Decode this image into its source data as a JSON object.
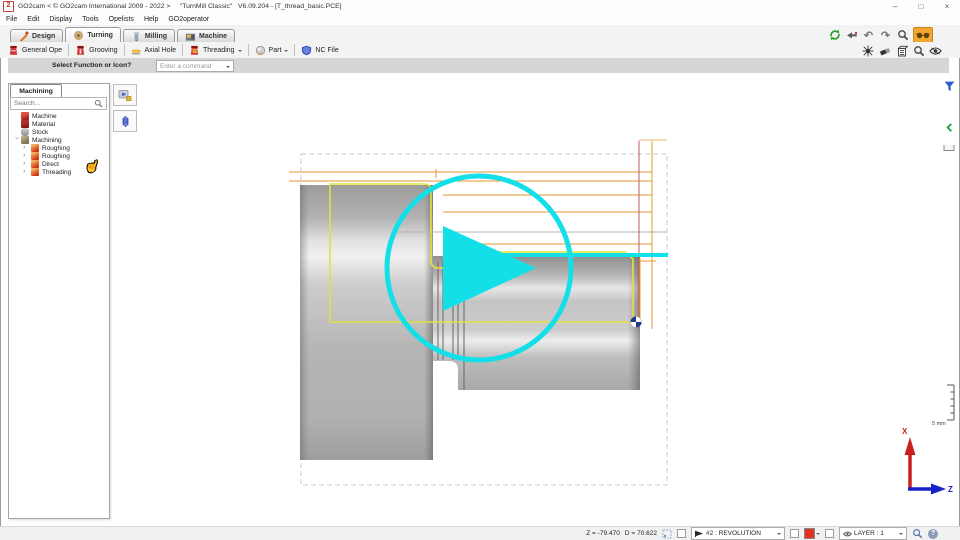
{
  "window": {
    "title": "GO2cam < © GO2cam International 2009 - 2022 >     \"TurnMill Classic\"   V6.09.204 - [T_thread_basic.PCE]",
    "logo": "2",
    "minimize": "–",
    "maximize": "□",
    "close": "×"
  },
  "menu": {
    "items": [
      "File",
      "Edit",
      "Display",
      "Tools",
      "Opelists",
      "Help",
      "GO2operator"
    ]
  },
  "ribbon": {
    "tabs": [
      {
        "label": "Design"
      },
      {
        "label": "Turning"
      },
      {
        "label": "Milling"
      },
      {
        "label": "Machine"
      }
    ],
    "active_tab": "Turning",
    "tools": [
      {
        "label": "General Ope"
      },
      {
        "label": "Grooving"
      },
      {
        "label": "Axial Hole"
      },
      {
        "label": "Threading"
      },
      {
        "label": "Part"
      },
      {
        "label": "NC File"
      }
    ],
    "view_icons_row1": [
      "regen-icon",
      "pointer-icon",
      "undo-icon",
      "redo-icon",
      "zoom-icon",
      "go2-glasses-icon"
    ],
    "view_icons_row2": [
      "spider-icon",
      "eraser-icon",
      "shading-icon",
      "zoom-plus-icon",
      "visibility-eye-icon"
    ]
  },
  "command_bar": {
    "label": "Select Function or Icon?",
    "placeholder": "Enter a command"
  },
  "left_panel": {
    "tab_label": "Machining",
    "search_placeholder": "Search...",
    "tree": [
      {
        "label": "Machine",
        "level": 0,
        "icon": "machine-icon"
      },
      {
        "label": "Material",
        "level": 0,
        "icon": "material-icon"
      },
      {
        "label": "Stock",
        "level": 0,
        "icon": "stock-icon"
      },
      {
        "label": "Machining",
        "level": 0,
        "icon": "machining-folder-icon",
        "expanded": true
      },
      {
        "label": "Roughing",
        "level": 1,
        "icon": "operation-icon"
      },
      {
        "label": "Roughing",
        "level": 1,
        "icon": "operation-icon"
      },
      {
        "label": "Direct",
        "level": 1,
        "icon": "operation-icon"
      },
      {
        "label": "Threading",
        "level": 1,
        "icon": "operation-icon"
      }
    ]
  },
  "side_buttons": [
    "simulation-icon",
    "turning-tool-icon"
  ],
  "right_edge_icons": [
    "filter-funnel-icon",
    "collapse-chevron-icon",
    "tray-icon"
  ],
  "viewport": {
    "scale_label": "5 mm",
    "axis_x": "X",
    "axis_z": "Z"
  },
  "status_bar": {
    "z_label": "Z =",
    "z_value": "-79.470",
    "d_label": "D =",
    "d_value": "70.622",
    "revolution_label": "#2 : REVOLUTION",
    "layer_label": "LAYER : 1",
    "help_label": "?"
  },
  "ui": {
    "tree_caret": "›",
    "undo_glyph": "↶",
    "redo_glyph": "↷",
    "hand_cursor": "☝"
  },
  "colors": {
    "play_cyan": "#13dfe9",
    "contour_yellow": "#e2e33c",
    "toolpath_orange": "#e8962e",
    "toolpath_maroon": "#b85e5e",
    "axis_x_red": "#cc2020",
    "axis_z_blue": "#1822c8",
    "go2_button_orange": "#f2a82e",
    "status_red_swatch": "#e03020"
  }
}
